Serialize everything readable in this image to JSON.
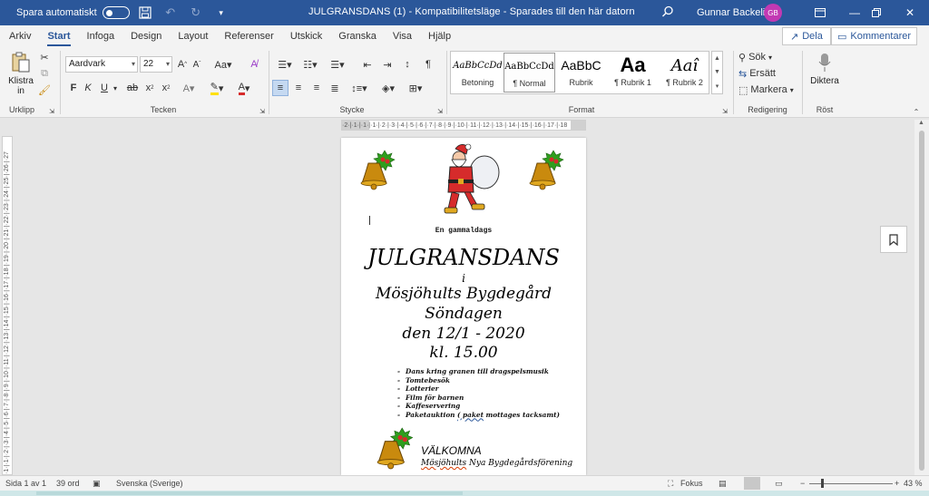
{
  "titlebar": {
    "autosave_label": "Spara automatiskt",
    "document_title": "JULGRANSDANS (1)  -  Kompatibilitetsläge  -  Sparades till den här datorn",
    "user_name": "Gunnar Backelin",
    "user_initials": "GB"
  },
  "tabs": [
    "Arkiv",
    "Start",
    "Infoga",
    "Design",
    "Layout",
    "Referenser",
    "Utskick",
    "Granska",
    "Visa",
    "Hjälp"
  ],
  "active_tab": "Start",
  "share": {
    "share_label": "Dela",
    "comments_label": "Kommentarer"
  },
  "ribbon": {
    "clipboard": {
      "paste_label": "Klistra in",
      "group_label": "Urklipp"
    },
    "font": {
      "font_name": "Aardvark",
      "font_size": "22",
      "group_label": "Tecken"
    },
    "paragraph": {
      "group_label": "Stycke"
    },
    "styles": {
      "group_label": "Format",
      "items": [
        {
          "preview": "AaBbCcDd",
          "name": "Betoning"
        },
        {
          "preview": "AaBbCcDd",
          "name": "¶ Normal"
        },
        {
          "preview": "AaBbC",
          "name": "Rubrik"
        },
        {
          "preview": "Aa",
          "name": "¶ Rubrik 1"
        },
        {
          "preview": "Aaî",
          "name": "¶ Rubrik 2"
        }
      ]
    },
    "editing": {
      "search_label": "Sök",
      "replace_label": "Ersätt",
      "select_label": "Markera",
      "group_label": "Redigering"
    },
    "voice": {
      "dictate_label": "Diktera",
      "group_label": "Röst"
    }
  },
  "ruler": {
    "horizontal": "·2·|·1·|·1·|·1·|·2·|·3·|·4·|·5·|·6·|·7·|·8·|·9·|·10·|·11·|·12·|·13·|·14·|·15·|·16·|·17·|·18",
    "vertical": "·1·|·1·|·2·|·3·|·4·|·5·|·6·|·7·|·8·|·9·|·10·|·11·|·12·|·13·|·14·|·15·|·16·|·17·|·18·|·19·|·20·|·21·|·22·|·23·|·24·|·25·|·26·|·27"
  },
  "document": {
    "subtitle": "En gammaldags",
    "title": "JULGRANSDANS",
    "line_i": "i",
    "venue": "Mösjöhults Bygdegård",
    "day": "Söndagen",
    "date": "den 12/1 - 2020",
    "time": "kl. 15.00",
    "bullets": [
      "Dans kring granen till dragspelsmusik",
      "Tomtebesök",
      "Lotterier",
      "Film för barnen",
      "Kaffeservering"
    ],
    "bullet_last_prefix": "Paketauktion ",
    "bullet_last_err": "( paket",
    "bullet_last_suffix": " mottages tacksamt)",
    "welcome": "VÄLKOMNA",
    "signature_err": "Mösjöhults",
    "signature_rest": " Nya Bygdegårdsförening"
  },
  "statusbar": {
    "page": "Sida 1 av 1",
    "words": "39 ord",
    "language": "Svenska (Sverige)",
    "focus_label": "Fokus",
    "zoom": "43 %"
  },
  "colors": {
    "accent": "#2b579a",
    "avatar": "#c239b3",
    "red": "#d62b2b",
    "gold": "#c98a0e",
    "green": "#2f9e1e"
  }
}
